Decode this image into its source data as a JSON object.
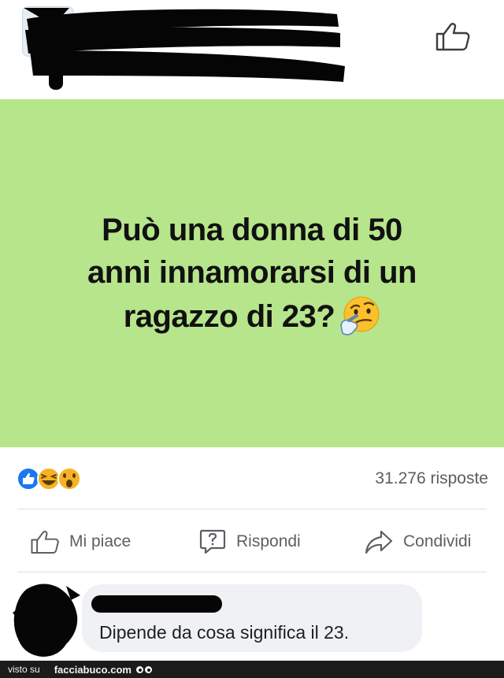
{
  "post": {
    "text_line1": "Può una donna di 50",
    "text_line2": "anni innamorarsi di un",
    "text_line3": "ragazzo di 23?",
    "emoji": "thinking-face-icon",
    "background": "#b7e58b"
  },
  "stats": {
    "reactions": [
      "like-reaction-icon",
      "haha-reaction-icon",
      "wow-reaction-icon"
    ],
    "replies_count": "31.276 risposte"
  },
  "actions": {
    "like_label": "Mi piace",
    "reply_label": "Rispondi",
    "share_label": "Condividi"
  },
  "comment": {
    "text": "Dipende da cosa significa il 23."
  },
  "footer": {
    "prefix": "visto su",
    "site": "facciabuco.com"
  },
  "colors": {
    "accent_blue": "#1877f2",
    "muted_text": "#5c5f64"
  }
}
